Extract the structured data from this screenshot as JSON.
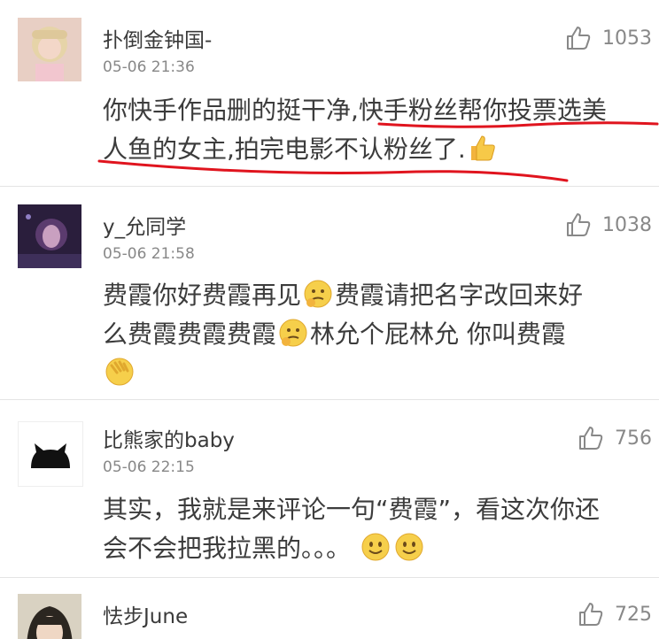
{
  "comments": [
    {
      "username": "扑倒金钟国-",
      "time": "05-06 21:36",
      "likes": "1053",
      "line1": "你快手作品删的挺干净,快手粉丝帮你投票选美",
      "line2": "人鱼的女主,拍完电影不认粉丝了.",
      "line2_emoji": "thumbs-up-emoji"
    },
    {
      "username": "y_允同学",
      "time": "05-06 21:58",
      "likes": "1038",
      "line1_a": "费霞你好费霞再见",
      "line1_b": "费霞请把名字改回来好",
      "line2_a": "么费霞费霞费霞",
      "line2_b": "林允个屁林允  你叫费霞",
      "emoji": "thinking-face-emoji"
    },
    {
      "username": "比熊家的baby",
      "time": "05-06 22:15",
      "likes": "756",
      "line1": "其实，我就是来评论一句“费霞”，看这次你还",
      "line2": "会不会把我拉黑的。。。",
      "emoji": "smiley-face-emoji"
    },
    {
      "username": "怯步June",
      "likes": "725"
    }
  ],
  "colors": {
    "annotation_red": "#e0141e",
    "divider": "#e4e4e4",
    "meta_gray": "#888888"
  }
}
